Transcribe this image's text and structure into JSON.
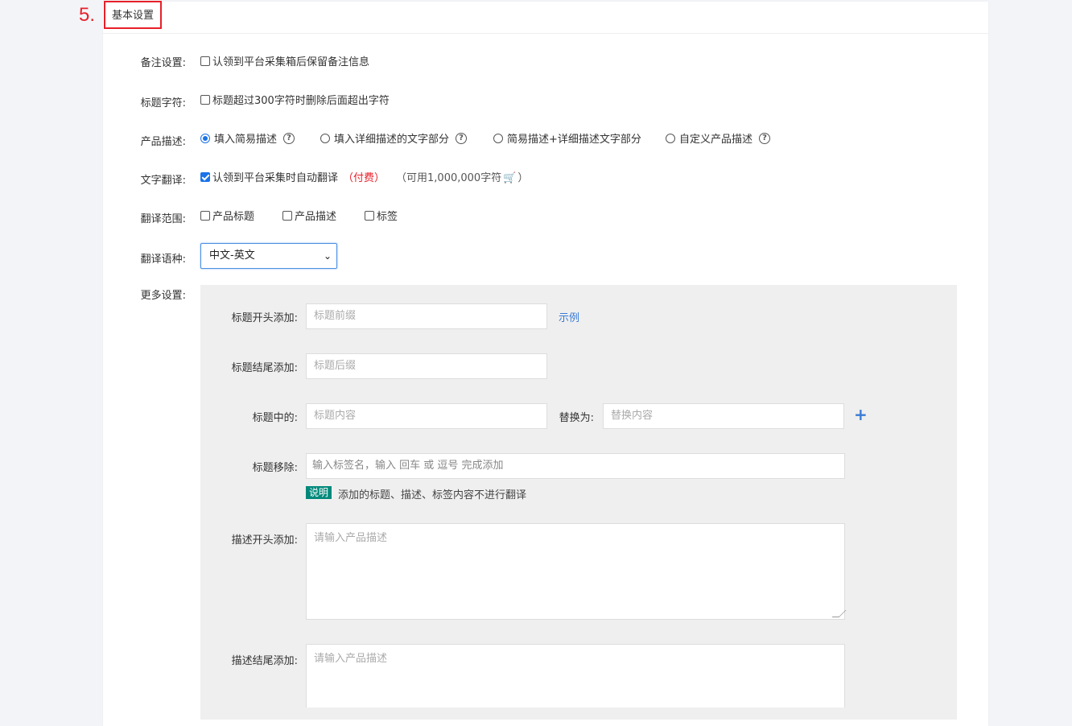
{
  "header": {
    "step_number": "5.",
    "section_title": "基本设置"
  },
  "rows": {
    "remark": {
      "label": "备注设置:",
      "option": "认领到平台采集箱后保留备注信息",
      "checked": false
    },
    "title_chars": {
      "label": "标题字符:",
      "option": "标题超过300字符时删除后面超出字符",
      "checked": false
    },
    "description": {
      "label": "产品描述:",
      "options": [
        {
          "text": "填入简易描述",
          "checked": true,
          "help": true
        },
        {
          "text": "填入详细描述的文字部分",
          "checked": false,
          "help": true
        },
        {
          "text": "简易描述+详细描述文字部分",
          "checked": false,
          "help": false
        },
        {
          "text": "自定义产品描述",
          "checked": false,
          "help": true
        }
      ]
    },
    "translation": {
      "label": "文字翻译:",
      "option": "认领到平台采集时自动翻译",
      "checked": true,
      "paid": "（付费）",
      "available_prefix": "（可用1,000,000字符",
      "available_suffix": "）"
    },
    "translate_scope": {
      "label": "翻译范围:",
      "options": [
        {
          "text": "产品标题",
          "checked": false
        },
        {
          "text": "产品描述",
          "checked": false
        },
        {
          "text": "标签",
          "checked": false
        }
      ]
    },
    "translate_lang": {
      "label": "翻译语种:",
      "selected": "中文-英文"
    },
    "more": {
      "label": "更多设置:"
    }
  },
  "more_settings": {
    "title_prefix": {
      "label": "标题开头添加:",
      "placeholder": "标题前缀",
      "example_link": "示例"
    },
    "title_suffix": {
      "label": "标题结尾添加:",
      "placeholder": "标题后缀"
    },
    "title_replace": {
      "label": "标题中的:",
      "placeholder": "标题内容",
      "replace_label": "替换为:",
      "replace_placeholder": "替换内容"
    },
    "title_remove": {
      "label": "标题移除:",
      "placeholder": "输入标签名，输入 回车 或 逗号 完成添加",
      "note_badge": "说明",
      "note_text": "添加的标题、描述、标签内容不进行翻译"
    },
    "desc_prefix": {
      "label": "描述开头添加:",
      "placeholder": "请输入产品描述"
    },
    "desc_suffix": {
      "label": "描述结尾添加:",
      "placeholder": "请输入产品描述"
    }
  },
  "colors": {
    "accent": "#3a7bd5",
    "highlight_red": "#e8202a",
    "badge_green": "#00897b"
  }
}
